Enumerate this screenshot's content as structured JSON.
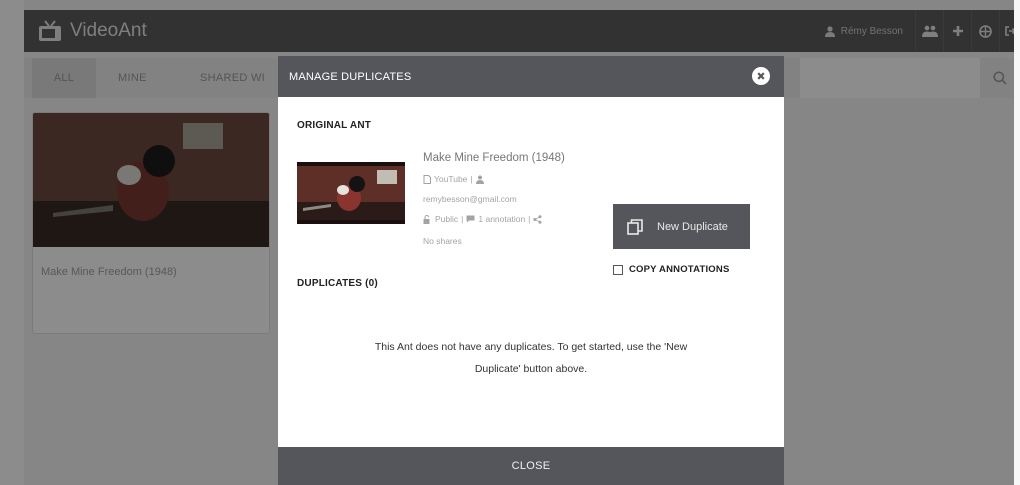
{
  "app": {
    "brand": "VideoAnt",
    "user_name": "Rémy Besson"
  },
  "filters": {
    "all": "ALL",
    "mine": "MINE",
    "shared": "SHARED WI"
  },
  "card": {
    "title": "Make Mine Freedom (1948)"
  },
  "modal": {
    "title": "MANAGE DUPLICATES",
    "original_heading": "ORIGINAL ANT",
    "ant": {
      "title": "Make Mine Freedom (1948)",
      "source": "YouTube",
      "email": "remybesson@gmail.com",
      "visibility": "Public",
      "annotations": "1 annotation",
      "shares": "No shares"
    },
    "new_duplicate_label": "New Duplicate",
    "copy_annotations_label": "COPY ANNOTATIONS",
    "duplicates_heading": "DUPLICATES (0)",
    "empty_line1": "This Ant does not have any duplicates. To get started, use the 'New",
    "empty_line2": "Duplicate' button above.",
    "close_label": "CLOSE"
  },
  "colors": {
    "modal_header": "#55565c",
    "navbar": "#5b5b5b"
  },
  "icons": [
    "tv-icon",
    "user-icon",
    "users-icon",
    "plus-icon",
    "globe-icon",
    "sign-out-icon",
    "search-icon",
    "close-circle-icon",
    "file-icon",
    "unlock-icon",
    "comment-icon",
    "share-icon",
    "copy-icon",
    "checkbox-icon"
  ]
}
